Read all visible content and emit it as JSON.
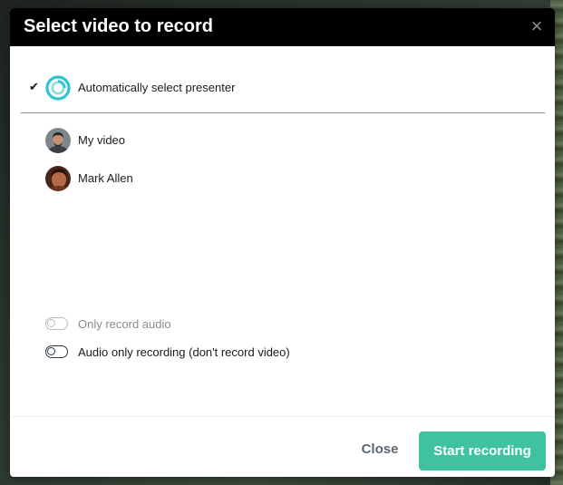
{
  "dialog": {
    "title": "Select video to record",
    "close_symbol": "×"
  },
  "options": [
    {
      "label": "Automatically select presenter",
      "selected": true,
      "check": "✔",
      "icon": "auto-presenter-icon"
    },
    {
      "label": "My video",
      "selected": false,
      "icon": "avatar-my-video"
    },
    {
      "label": "Mark Allen",
      "selected": false,
      "icon": "avatar-mark-allen"
    }
  ],
  "toggles": [
    {
      "label": "Only record audio",
      "enabled": false,
      "on": false
    },
    {
      "label": "Audio only recording (don't record video)",
      "enabled": true,
      "on": false
    }
  ],
  "footer": {
    "close_label": "Close",
    "start_label": "Start recording"
  },
  "colors": {
    "accent": "#3ec2a0",
    "header_bg": "#000000",
    "presenter_icon": "#2ec4d6"
  }
}
